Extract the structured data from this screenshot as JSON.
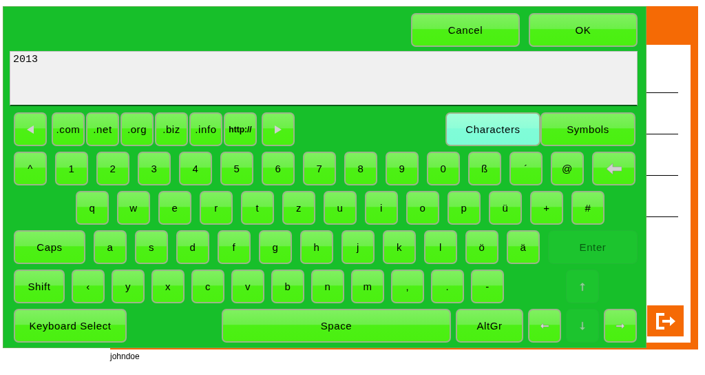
{
  "dialog": {
    "buttons": [
      {
        "label": "Cancel"
      },
      {
        "label": "OK"
      }
    ],
    "input": {
      "value": "2013"
    },
    "domain_row": [
      {
        "kind": "prev",
        "disabled": false
      },
      {
        "kind": "domain",
        "label": ".com",
        "disabled": false
      },
      {
        "kind": "domain",
        "label": ".net",
        "disabled": false
      },
      {
        "kind": "domain",
        "label": ".org",
        "disabled": false
      },
      {
        "kind": "domain",
        "label": ".biz",
        "disabled": false
      },
      {
        "kind": "domain",
        "label": ".info",
        "disabled": false
      },
      {
        "kind": "domain",
        "label": "http://",
        "disabled": false
      },
      {
        "kind": "next",
        "disabled": false
      }
    ],
    "mode_tabs": [
      {
        "label": "Characters",
        "selected": true
      },
      {
        "label": "Symbols",
        "selected": false
      }
    ],
    "rows": [
      [
        {
          "kind": "char",
          "label": "^",
          "disabled": false
        },
        {
          "kind": "char",
          "label": "1",
          "disabled": false
        },
        {
          "kind": "char",
          "label": "2",
          "disabled": false
        },
        {
          "kind": "char",
          "label": "3",
          "disabled": false
        },
        {
          "kind": "char",
          "label": "4",
          "disabled": false
        },
        {
          "kind": "char",
          "label": "5",
          "disabled": false
        },
        {
          "kind": "char",
          "label": "6",
          "disabled": false
        },
        {
          "kind": "char",
          "label": "7",
          "disabled": false
        },
        {
          "kind": "char",
          "label": "8",
          "disabled": false
        },
        {
          "kind": "char",
          "label": "9",
          "disabled": false
        },
        {
          "kind": "char",
          "label": "0",
          "disabled": false
        },
        {
          "kind": "char",
          "label": "ß",
          "disabled": false
        },
        {
          "kind": "char",
          "label": "´",
          "disabled": false
        },
        {
          "kind": "char",
          "label": "@",
          "disabled": false
        },
        {
          "kind": "backspace",
          "disabled": false
        }
      ],
      [
        {
          "kind": "char",
          "label": "q",
          "disabled": false
        },
        {
          "kind": "char",
          "label": "w",
          "disabled": false
        },
        {
          "kind": "char",
          "label": "e",
          "disabled": false
        },
        {
          "kind": "char",
          "label": "r",
          "disabled": false
        },
        {
          "kind": "char",
          "label": "t",
          "disabled": false
        },
        {
          "kind": "char",
          "label": "z",
          "disabled": false
        },
        {
          "kind": "char",
          "label": "u",
          "disabled": false
        },
        {
          "kind": "char",
          "label": "i",
          "disabled": false
        },
        {
          "kind": "char",
          "label": "o",
          "disabled": false
        },
        {
          "kind": "char",
          "label": "p",
          "disabled": false
        },
        {
          "kind": "char",
          "label": "ü",
          "disabled": false
        },
        {
          "kind": "char",
          "label": "+",
          "disabled": false
        },
        {
          "kind": "char",
          "label": "#",
          "disabled": false
        }
      ],
      [
        {
          "kind": "caps",
          "label": "Caps",
          "disabled": false
        },
        {
          "kind": "char",
          "label": "a",
          "disabled": false
        },
        {
          "kind": "char",
          "label": "s",
          "disabled": false
        },
        {
          "kind": "char",
          "label": "d",
          "disabled": false
        },
        {
          "kind": "char",
          "label": "f",
          "disabled": false
        },
        {
          "kind": "char",
          "label": "g",
          "disabled": false
        },
        {
          "kind": "char",
          "label": "h",
          "disabled": false
        },
        {
          "kind": "char",
          "label": "j",
          "disabled": false
        },
        {
          "kind": "char",
          "label": "k",
          "disabled": false
        },
        {
          "kind": "char",
          "label": "l",
          "disabled": false
        },
        {
          "kind": "char",
          "label": "ö",
          "disabled": false
        },
        {
          "kind": "char",
          "label": "ä",
          "disabled": false
        },
        {
          "kind": "enter",
          "label": "Enter",
          "disabled": true
        }
      ],
      [
        {
          "kind": "shift",
          "label": "Shift",
          "disabled": false
        },
        {
          "kind": "char",
          "label": "‹",
          "disabled": false
        },
        {
          "kind": "char",
          "label": "y",
          "disabled": false
        },
        {
          "kind": "char",
          "label": "x",
          "disabled": false
        },
        {
          "kind": "char",
          "label": "c",
          "disabled": false
        },
        {
          "kind": "char",
          "label": "v",
          "disabled": false
        },
        {
          "kind": "char",
          "label": "b",
          "disabled": false
        },
        {
          "kind": "char",
          "label": "n",
          "disabled": false
        },
        {
          "kind": "char",
          "label": "m",
          "disabled": false
        },
        {
          "kind": "char",
          "label": ",",
          "disabled": false
        },
        {
          "kind": "char",
          "label": ".",
          "disabled": false
        },
        {
          "kind": "char",
          "label": "-",
          "disabled": false
        },
        {
          "kind": "up",
          "disabled": true
        }
      ],
      [
        {
          "kind": "select",
          "label": "Keyboard Select",
          "disabled": false
        },
        {
          "kind": "space",
          "label": "Space",
          "disabled": false
        },
        {
          "kind": "altgr",
          "label": "AltGr",
          "disabled": false
        },
        {
          "kind": "left",
          "disabled": false
        },
        {
          "kind": "down",
          "disabled": true
        },
        {
          "kind": "right",
          "disabled": false
        }
      ]
    ]
  },
  "user": {
    "name": "johndoe"
  }
}
